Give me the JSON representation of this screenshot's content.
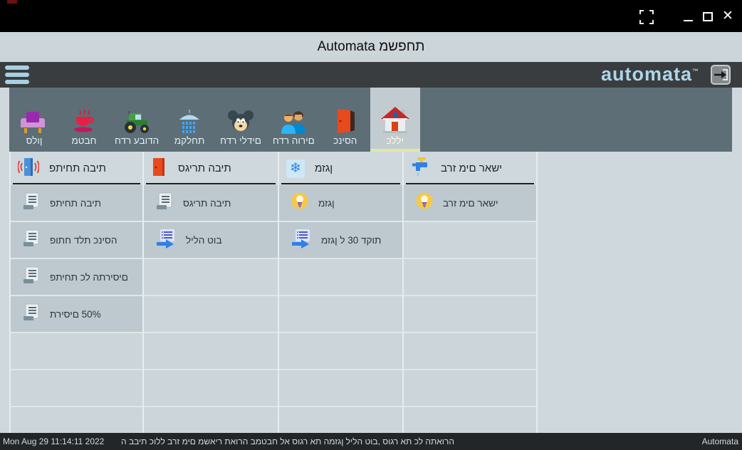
{
  "window": {
    "title": "Automata משפחת",
    "controls": {
      "fullscreen": "fullscreen-toggle",
      "minimize": "minimize",
      "maximize": "maximize",
      "close": "close"
    }
  },
  "app_bar": {
    "logo": "automata",
    "logo_tm": "™",
    "menu_icon": "hamburger-menu",
    "exit_icon": "exit-arrow"
  },
  "tabs": [
    {
      "label": "סלון",
      "icon": "sofa-icon",
      "selected": false
    },
    {
      "label": "מטבח",
      "icon": "coffee-cup-icon",
      "selected": false
    },
    {
      "label": "חדר עבודה",
      "icon": "tractor-icon",
      "selected": false
    },
    {
      "label": "מקלחת",
      "icon": "shower-icon",
      "selected": false
    },
    {
      "label": "חדר ילדים",
      "icon": "mickey-icon",
      "selected": false
    },
    {
      "label": "חדר הורים",
      "icon": "parents-icon",
      "selected": false
    },
    {
      "label": "כניסה",
      "icon": "door-icon",
      "selected": false
    },
    {
      "label": "כללי",
      "icon": "house-icon",
      "selected": true
    }
  ],
  "board": {
    "columns": [
      {
        "header": "פתיחת הבית",
        "header_icon": "door-alarm-icon",
        "items": [
          {
            "label": "פתיחת הבית",
            "icon": "list-icon"
          },
          {
            "label": "פותח דלת כניסה",
            "icon": "list-icon"
          },
          {
            "label": "פתיחת כל התריסים",
            "icon": "list-icon"
          },
          {
            "label": "תריסים 50%",
            "icon": "list-icon"
          }
        ]
      },
      {
        "header": "סגירת הבית",
        "header_icon": "door-closed-icon",
        "items": [
          {
            "label": "סגירת הבית",
            "icon": "list-icon"
          },
          {
            "label": "לילה טוב",
            "icon": "scenario-run-icon"
          }
        ]
      },
      {
        "header": "מזגן",
        "header_icon": "snowflake-icon",
        "items": [
          {
            "label": "מזגן",
            "icon": "bulb-icon"
          },
          {
            "label": "מזגן ל 30 דקות",
            "icon": "scenario-run-icon"
          }
        ]
      },
      {
        "header": "ברז מים ראשי",
        "header_icon": "faucet-icon",
        "items": [
          {
            "label": "ברז מים ראשי",
            "icon": "bulb-icon"
          }
        ]
      }
    ]
  },
  "status_bar": {
    "timestamp": "Mon Aug 29 11:14:11 2022",
    "message": "ה בבית כולל ברז מים משאיר תאורה במטבח לא סוגר את המזגן  לילה טוב, סוגר את כל התאורה",
    "app_name": "Automata"
  },
  "colors": {
    "logo": "#aed6e8",
    "app_bar_bg": "#3a3d3f",
    "tab_bar_bg": "#5d6e76",
    "selected_tab_bg": "#c2ccd0",
    "selected_tab_underline": "#dde8a8",
    "content_bg": "#cfd8dc",
    "filled_cell_bg": "#bdc9cf",
    "empty_cell_bg": "#ccd6da",
    "status_bar_bg": "#232628",
    "title_bar_bg": "#ccd5d9"
  }
}
